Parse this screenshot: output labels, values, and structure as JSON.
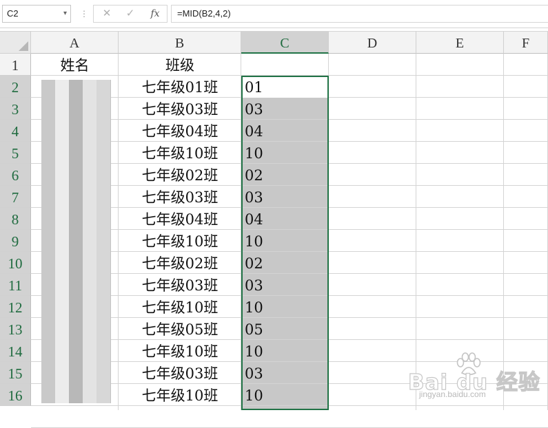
{
  "formula_bar": {
    "name_box": "C2",
    "cancel_icon": "✕",
    "enter_icon": "✓",
    "fx_label": "fx",
    "formula": "=MID(B2,4,2)"
  },
  "columns": [
    "A",
    "B",
    "C",
    "D",
    "E",
    "F"
  ],
  "selected_column": "C",
  "rows": [
    "1",
    "2",
    "3",
    "4",
    "5",
    "6",
    "7",
    "8",
    "9",
    "10",
    "11",
    "12",
    "13",
    "14",
    "15",
    "16"
  ],
  "header_row": {
    "A": "姓名",
    "B": "班级",
    "C": ""
  },
  "data": [
    {
      "row": "2",
      "B": "七年级01班",
      "C": "01"
    },
    {
      "row": "3",
      "B": "七年级03班",
      "C": "03"
    },
    {
      "row": "4",
      "B": "七年级04班",
      "C": "04"
    },
    {
      "row": "5",
      "B": "七年级10班",
      "C": "10"
    },
    {
      "row": "6",
      "B": "七年级02班",
      "C": "02"
    },
    {
      "row": "7",
      "B": "七年级03班",
      "C": "03"
    },
    {
      "row": "8",
      "B": "七年级04班",
      "C": "04"
    },
    {
      "row": "9",
      "B": "七年级10班",
      "C": "10"
    },
    {
      "row": "10",
      "B": "七年级02班",
      "C": "02"
    },
    {
      "row": "11",
      "B": "七年级03班",
      "C": "03"
    },
    {
      "row": "12",
      "B": "七年级10班",
      "C": "10"
    },
    {
      "row": "13",
      "B": "七年级05班",
      "C": "05"
    },
    {
      "row": "14",
      "B": "七年级10班",
      "C": "10"
    },
    {
      "row": "15",
      "B": "七年级03班",
      "C": "03"
    },
    {
      "row": "16",
      "B": "七年级10班",
      "C": "10"
    }
  ],
  "colors": {
    "selection_border": "#217346",
    "selection_fill": "#c8c8c8",
    "header_selected_text": "#1f6b3f"
  },
  "watermark": {
    "brand": "Bai du 经验",
    "url": "jingyan.baidu.com"
  }
}
